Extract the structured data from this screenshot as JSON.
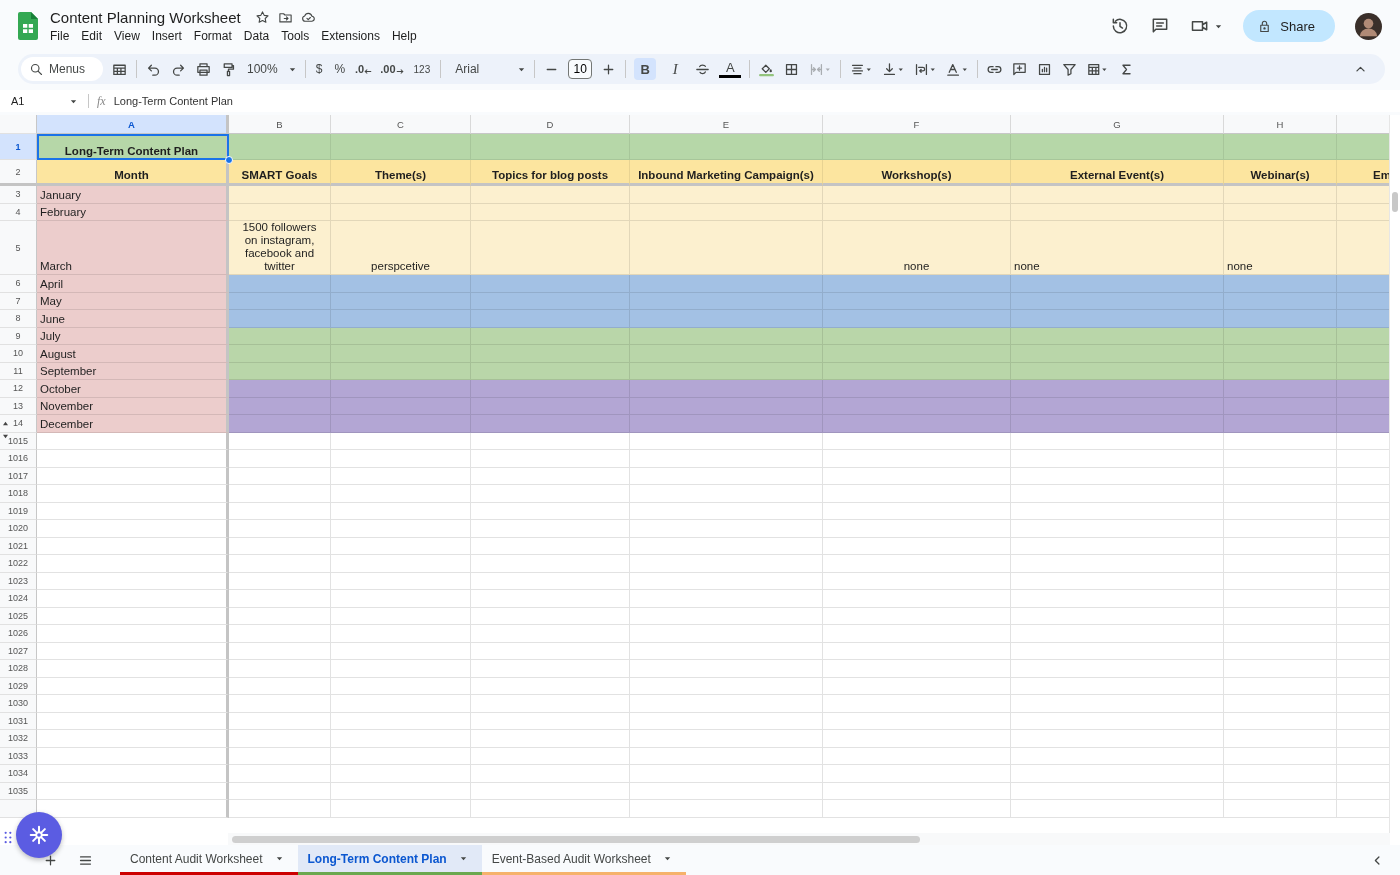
{
  "document": {
    "title": "Content Planning Worksheet"
  },
  "menu": [
    "File",
    "Edit",
    "View",
    "Insert",
    "Format",
    "Data",
    "Tools",
    "Extensions",
    "Help"
  ],
  "share": {
    "label": "Share"
  },
  "toolbar": {
    "search_placeholder": "Menus",
    "zoom": "100%",
    "currency": "$",
    "percent": "%",
    "decrease_decimal": ".0",
    "increase_decimal": ".00",
    "more_formats": "123",
    "font": "Arial",
    "font_size": "10",
    "bold": {
      "label": "B",
      "selected": true
    },
    "italic": {
      "label": "I",
      "selected": false
    },
    "text_color": {
      "label": "A"
    },
    "merge": {
      "disabled": true
    }
  },
  "formula_bar": {
    "cell": "A1",
    "fx": "fx",
    "value": "Long-Term Content Plan"
  },
  "columns": [
    {
      "letter": "A",
      "selected": true
    },
    {
      "letter": "B",
      "selected": false
    },
    {
      "letter": "C",
      "selected": false
    },
    {
      "letter": "D",
      "selected": false
    },
    {
      "letter": "E",
      "selected": false
    },
    {
      "letter": "F",
      "selected": false
    },
    {
      "letter": "G",
      "selected": false
    },
    {
      "letter": "H",
      "selected": false
    }
  ],
  "rows": [
    {
      "number": "1",
      "kind": "header",
      "selected": true,
      "color": "#b6d7a8",
      "cells": {
        "A": {
          "text": "Long-Term Content Plan",
          "centered": true
        }
      }
    },
    {
      "number": "2",
      "kind": "header",
      "selected": false,
      "color": "#fce59f",
      "cells": {
        "A": {
          "text": "Month",
          "centered": true
        },
        "B": {
          "text": "SMART Goals",
          "centered": true
        },
        "C": {
          "text": "Theme(s)",
          "centered": true
        },
        "D": {
          "text": "Topics for blog posts",
          "centered": true
        },
        "E": {
          "text": "Inbound Marketing Campaign(s)",
          "centered": true
        },
        "F": {
          "text": "Workshop(s)",
          "centered": true
        },
        "G": {
          "text": "External Event(s)",
          "centered": true
        },
        "H": {
          "text": "Webinar(s)",
          "centered": true
        },
        "I": {
          "text": "Em",
          "centered": false
        }
      }
    },
    {
      "number": "3",
      "kind": "data",
      "selected": false,
      "color": "#fcf0cf",
      "cells": {
        "A": {
          "text": "January",
          "centered": false,
          "color": "#eccdcc"
        }
      }
    },
    {
      "number": "4",
      "kind": "data",
      "selected": false,
      "color": "#fcf0cf",
      "cells": {
        "A": {
          "text": "February",
          "centered": false,
          "color": "#eccdcc"
        }
      }
    },
    {
      "number": "5",
      "kind": "data",
      "selected": false,
      "color": "#fcf0cf",
      "cells": {
        "A": {
          "text": "March",
          "centered": false,
          "color": "#eccdcc"
        },
        "B": {
          "text": "1500 followers on instagram, facebook and twitter",
          "centered": true
        },
        "C": {
          "text": "perspcetive",
          "centered": true
        },
        "F": {
          "text": "none",
          "centered": true
        },
        "G": {
          "text": "none",
          "centered": false
        },
        "H": {
          "text": "none",
          "centered": false
        }
      }
    },
    {
      "number": "6",
      "kind": "data",
      "selected": false,
      "color": "#a3c1e4",
      "cells": {
        "A": {
          "text": "April",
          "centered": false,
          "color": "#eccdcc"
        }
      }
    },
    {
      "number": "7",
      "kind": "data",
      "selected": false,
      "color": "#a3c1e4",
      "cells": {
        "A": {
          "text": "May",
          "centered": false,
          "color": "#eccdcc"
        }
      }
    },
    {
      "number": "8",
      "kind": "data",
      "selected": false,
      "color": "#a3c1e4",
      "cells": {
        "A": {
          "text": "June",
          "centered": false,
          "color": "#eccdcc"
        }
      }
    },
    {
      "number": "9",
      "kind": "data",
      "selected": false,
      "color": "#b9d6a9",
      "cells": {
        "A": {
          "text": "July",
          "centered": false,
          "color": "#eccdcc"
        }
      }
    },
    {
      "number": "10",
      "kind": "data",
      "selected": false,
      "color": "#b9d6a9",
      "cells": {
        "A": {
          "text": "August",
          "centered": false,
          "color": "#eccdcc"
        }
      }
    },
    {
      "number": "11",
      "kind": "data",
      "selected": false,
      "color": "#b9d6a9",
      "cells": {
        "A": {
          "text": "September",
          "centered": false,
          "color": "#eccdcc"
        }
      }
    },
    {
      "number": "12",
      "kind": "data",
      "selected": false,
      "color": "#b3a6d4",
      "cells": {
        "A": {
          "text": "October",
          "centered": false,
          "color": "#eccdcc"
        }
      }
    },
    {
      "number": "13",
      "kind": "data",
      "selected": false,
      "color": "#b3a6d4",
      "cells": {
        "A": {
          "text": "November",
          "centered": false,
          "color": "#eccdcc"
        }
      }
    },
    {
      "number": "14",
      "kind": "data",
      "selected": false,
      "color": "#b3a6d4",
      "cells": {
        "A": {
          "text": "December",
          "centered": false,
          "color": "#eccdcc"
        }
      }
    }
  ],
  "empty_rows": [
    "1015",
    "1016",
    "1017",
    "1018",
    "1019",
    "1020",
    "1021",
    "1022",
    "1023",
    "1024",
    "1025",
    "1026",
    "1027",
    "1028",
    "1029",
    "1030",
    "1031",
    "1032",
    "1033",
    "1034",
    "1035"
  ],
  "sheet_tabs": [
    {
      "label": "Content Audit Worksheet",
      "selected": false,
      "color": "#cc0000"
    },
    {
      "label": "Long-Term Content Plan",
      "selected": true,
      "color": "#6aa84f"
    },
    {
      "label": "Event-Based Audit Worksheet",
      "selected": false,
      "color": "#f6b26b"
    }
  ]
}
